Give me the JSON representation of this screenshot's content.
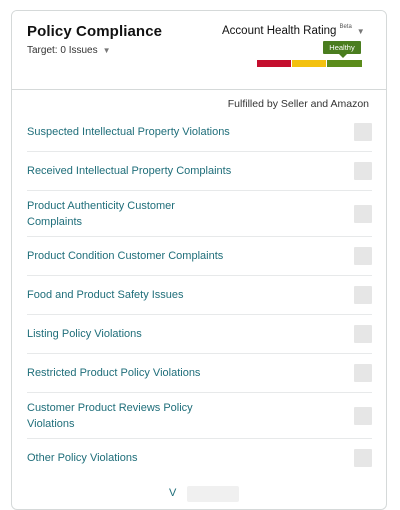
{
  "card": {
    "title": "Policy Compliance",
    "target_label": "Target: 0 Issues",
    "target_chevron": "chevron-down-icon",
    "account_health": {
      "label": "Account Health Rating",
      "beta": "Beta",
      "status": "Healthy",
      "status_color": "#4a7d1f",
      "bar_colors": [
        "#c40e2e",
        "#f3c10f",
        "#5b8c1b"
      ]
    },
    "column_header": "Fulfilled by Seller and Amazon",
    "rows": [
      {
        "label": "Suspected Intellectual Property Violations"
      },
      {
        "label": "Received Intellectual Property Complaints"
      },
      {
        "label": "Product Authenticity Customer Complaints"
      },
      {
        "label": "Product Condition Customer Complaints"
      },
      {
        "label": "Food and Product Safety Issues"
      },
      {
        "label": "Listing Policy Violations"
      },
      {
        "label": "Restricted Product Policy Violations"
      },
      {
        "label": "Customer Product Reviews Policy Violations"
      },
      {
        "label": "Other Policy Violations"
      }
    ],
    "footer_link": "V"
  }
}
